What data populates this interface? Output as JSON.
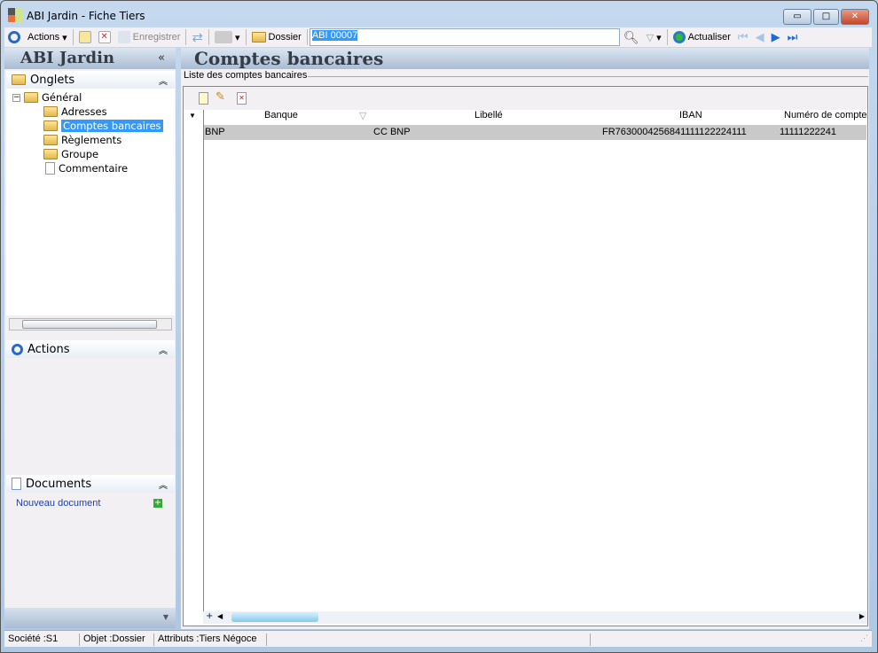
{
  "window": {
    "title": "ABI Jardin -  Fiche Tiers",
    "minimize": "▭",
    "maximize": "□",
    "close": "✕"
  },
  "toolbar": {
    "actions": "Actions",
    "save": "Enregistrer",
    "dossier": "Dossier",
    "search_value": "ABI 00007",
    "refresh": "Actualiser"
  },
  "sidebar": {
    "title": "ABI Jardin",
    "collapse": "«",
    "onglets": {
      "title": "Onglets",
      "root": "Général",
      "items": [
        "Adresses",
        "Comptes bancaires",
        "Règlements",
        "Groupe",
        "Commentaire"
      ]
    },
    "actions": {
      "title": "Actions"
    },
    "documents": {
      "title": "Documents",
      "new_doc": "Nouveau document"
    }
  },
  "main": {
    "title": "Comptes bancaires",
    "group_label": "Liste des comptes bancaires",
    "columns": [
      "Banque",
      "Libellé",
      "IBAN",
      "Numéro de compte"
    ],
    "rows": [
      [
        "BNP",
        "CC BNP",
        "FR7630004256841111122224111",
        "11111222241"
      ]
    ]
  },
  "status": {
    "societe": "Société :S1",
    "objet": "Objet :Dossier",
    "attributs": "Attributs :Tiers Négoce"
  }
}
